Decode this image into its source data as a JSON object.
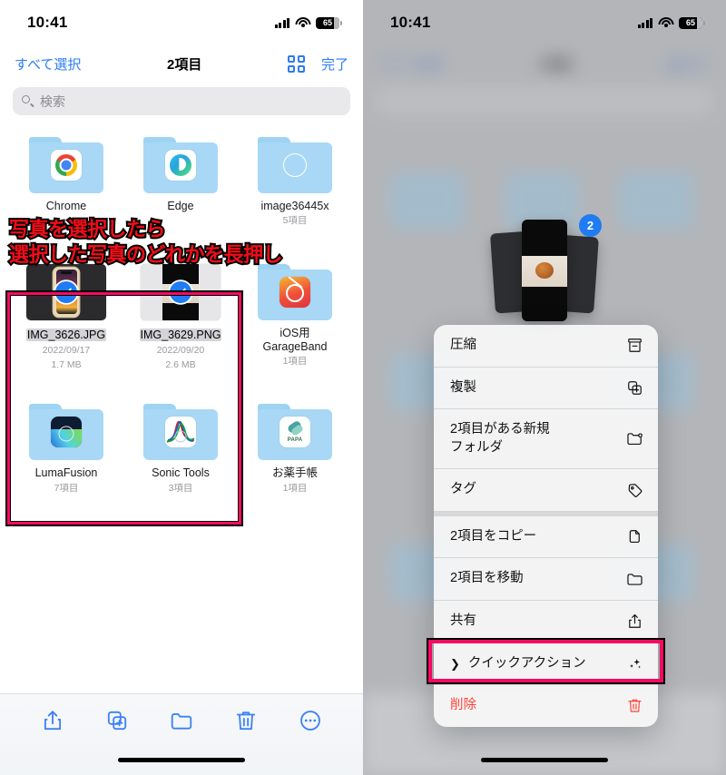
{
  "left_panel": {
    "status_bar": {
      "time": "10:41",
      "battery": "65",
      "signal_icon": "cellular-bars-icon",
      "wifi_icon": "wifi-icon",
      "battery_icon": "battery-icon"
    },
    "nav": {
      "select_all_label": "すべて選択",
      "title": "2項目",
      "grid_icon": "grid-view-icon",
      "done_label": "完了"
    },
    "search": {
      "placeholder": "検索",
      "icon": "search-icon"
    },
    "row1": [
      {
        "name": "Chrome",
        "meta": "",
        "kind": "folder",
        "art": "chrome-app-icon"
      },
      {
        "name": "Edge",
        "meta": "",
        "kind": "folder",
        "art": "edge-app-icon"
      },
      {
        "name": "image36445x",
        "meta": "5項目",
        "kind": "folder",
        "art": "empty-circle-icon"
      }
    ],
    "row2": [
      {
        "name": "IMG_3626.JPG",
        "date": "2022/09/17",
        "size": "1.7 MB",
        "kind": "photo",
        "selected": true
      },
      {
        "name": "IMG_3629.PNG",
        "date": "2022/09/20",
        "size": "2.6 MB",
        "kind": "photo",
        "selected": true
      },
      {
        "name": "iOS用\nGarageBand",
        "meta": "1項目",
        "kind": "folder",
        "art": "garageband-app-icon"
      }
    ],
    "row3": [
      {
        "name": "LumaFusion",
        "meta": "7項目",
        "kind": "folder",
        "art": "lumafusion-app-icon"
      },
      {
        "name": "Sonic Tools",
        "meta": "3項目",
        "kind": "folder",
        "art": "sonictools-app-icon"
      },
      {
        "name": "お薬手帳",
        "meta": "1項目",
        "kind": "folder",
        "art": "okusuri-app-icon"
      }
    ],
    "toolbar": [
      {
        "icon": "share-icon"
      },
      {
        "icon": "duplicate-icon"
      },
      {
        "icon": "move-to-folder-icon"
      },
      {
        "icon": "trash-icon"
      },
      {
        "icon": "more-ellipsis-icon"
      }
    ],
    "annotations": {
      "line1": "写真を選択したら",
      "line2": "選択した写真のどれかを長押し"
    }
  },
  "right_panel": {
    "status_bar": {
      "time": "10:41",
      "battery": "65"
    },
    "drag_preview": {
      "badge_count": "2"
    },
    "menu": [
      {
        "label": "圧縮",
        "icon": "archive-box-icon",
        "danger": false,
        "chevron": false
      },
      {
        "label": "複製",
        "icon": "duplicate-icon",
        "danger": false,
        "chevron": false
      },
      {
        "label": "2項目がある新規\nフォルダ",
        "icon": "new-folder-icon",
        "danger": false,
        "chevron": false
      },
      {
        "label": "タグ",
        "icon": "tag-icon",
        "danger": false,
        "chevron": false
      },
      {
        "label": "2項目をコピー",
        "icon": "copy-icon",
        "danger": false,
        "chevron": false,
        "group_break": true
      },
      {
        "label": "2項目を移動",
        "icon": "folder-icon",
        "danger": false,
        "chevron": false
      },
      {
        "label": "共有",
        "icon": "share-icon",
        "danger": false,
        "chevron": false
      },
      {
        "label": "クイックアクション",
        "icon": "sparkles-icon",
        "danger": false,
        "chevron": true,
        "highlighted": true
      },
      {
        "label": "削除",
        "icon": "trash-icon",
        "danger": true,
        "chevron": false
      }
    ]
  },
  "colors": {
    "ios_blue": "#2a7bf6",
    "annotation_pink": "#f40a63",
    "annotation_red": "#f20d18",
    "danger_red": "#ff4136",
    "folder_blue": "#a8d8f5"
  }
}
